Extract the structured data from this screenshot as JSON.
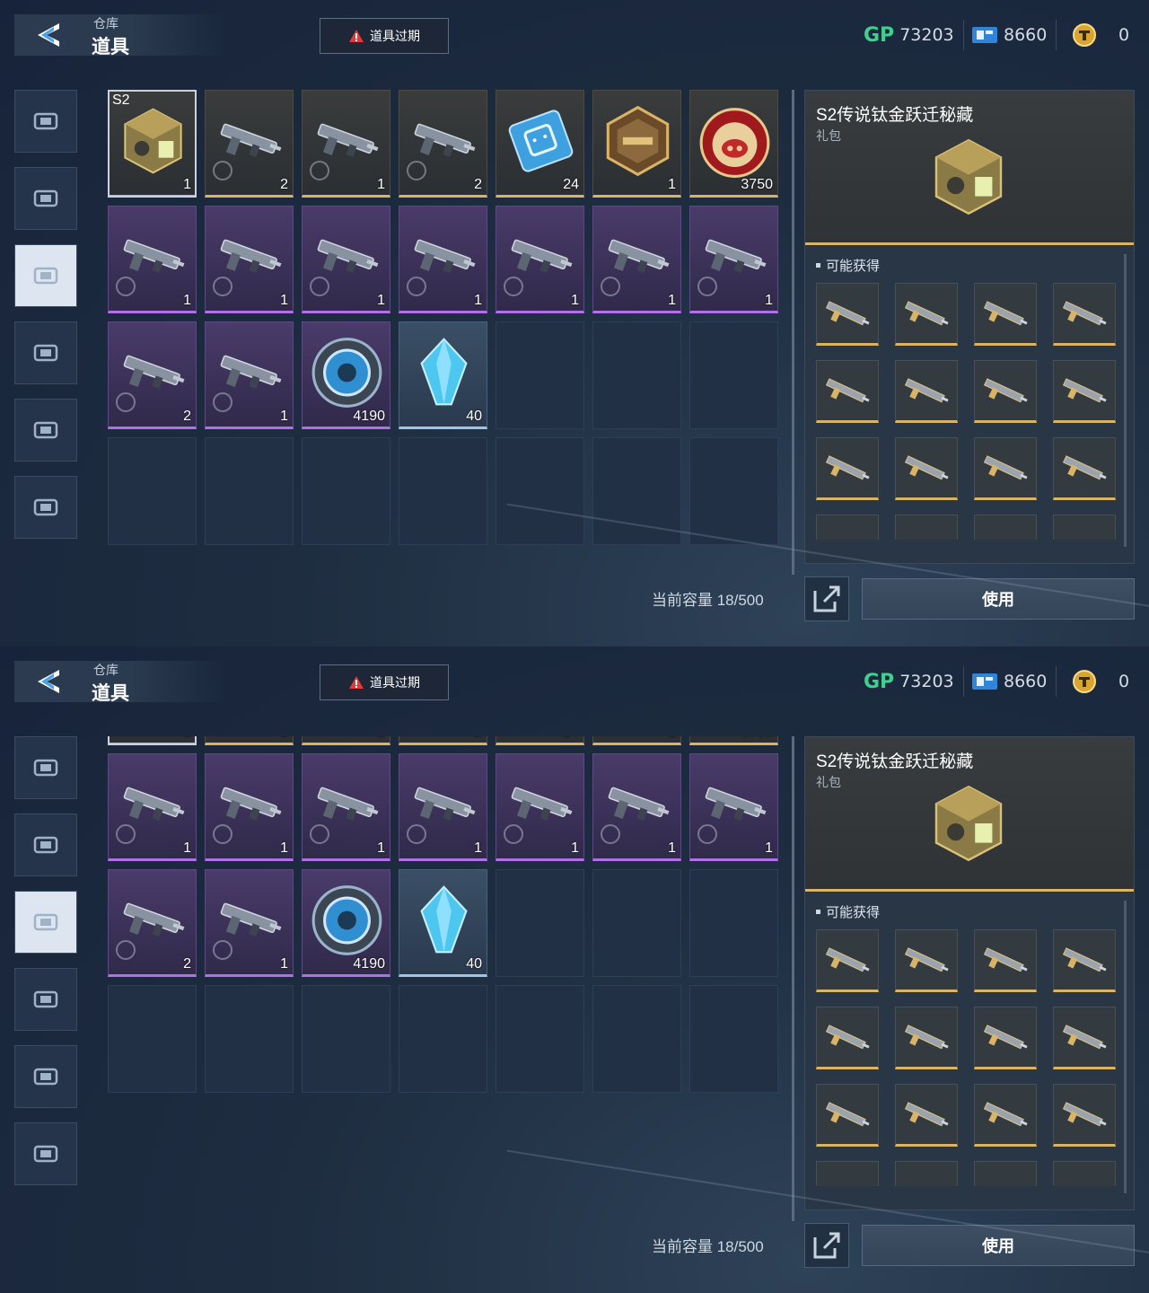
{
  "header": {
    "crumb": "仓库",
    "title": "道具",
    "expire_label": "道具过期",
    "currencies": [
      {
        "icon": "gp-icon",
        "label": "GP",
        "value": "73203"
      },
      {
        "icon": "ticket-icon",
        "value": "8660"
      },
      {
        "icon": "coin-icon",
        "value": "0"
      }
    ]
  },
  "sidebar": {
    "tabs": [
      {
        "icon": "pistol-icon",
        "active": false
      },
      {
        "icon": "frame-icon",
        "active": false
      },
      {
        "icon": "consumable-icon",
        "active": true
      },
      {
        "icon": "gun-swap-icon",
        "active": false
      },
      {
        "icon": "compass-icon",
        "active": false
      },
      {
        "icon": "star-badge-icon",
        "active": false
      }
    ]
  },
  "inventory": {
    "rows": [
      [
        {
          "name": "gift-crate",
          "rarity": "gold",
          "tag": "S2",
          "count": "1",
          "selected": true
        },
        {
          "name": "rifle-skin",
          "rarity": "gold",
          "count": "2",
          "timed": true
        },
        {
          "name": "pistol-skin",
          "rarity": "gold",
          "count": "1",
          "timed": true
        },
        {
          "name": "blade-skin",
          "rarity": "gold",
          "count": "2",
          "timed": true
        },
        {
          "name": "chip-card",
          "rarity": "gold",
          "count": "24"
        },
        {
          "name": "hex-badge",
          "rarity": "gold",
          "count": "1"
        },
        {
          "name": "pig-coin",
          "rarity": "gold",
          "count": "3750",
          "timer": true
        }
      ],
      [
        {
          "name": "smg-skin",
          "rarity": "purple",
          "count": "1",
          "timed": true
        },
        {
          "name": "ar-skin-green",
          "rarity": "purple",
          "count": "1",
          "timed": true
        },
        {
          "name": "rocket-skin",
          "rarity": "purple",
          "count": "1",
          "timed": true
        },
        {
          "name": "bow-skin",
          "rarity": "purple",
          "count": "1",
          "timed": true
        },
        {
          "name": "ar-skin-camo",
          "rarity": "purple",
          "count": "1",
          "timed": true
        },
        {
          "name": "shotgun-skin",
          "rarity": "purple",
          "count": "1",
          "timed": true
        },
        {
          "name": "smg-skin-white",
          "rarity": "purple",
          "count": "1",
          "timed": true
        }
      ],
      [
        {
          "name": "bow-skin-b",
          "rarity": "purple",
          "count": "2",
          "timed": true
        },
        {
          "name": "bow-skin-c",
          "rarity": "purple",
          "count": "1",
          "timed": true
        },
        {
          "name": "token-disc",
          "rarity": "purple",
          "count": "4190"
        },
        {
          "name": "crystal",
          "rarity": "blue",
          "count": "40"
        },
        {
          "empty": true
        },
        {
          "empty": true
        },
        {
          "empty": true
        }
      ],
      [
        {
          "empty": true
        },
        {
          "empty": true
        },
        {
          "empty": true
        },
        {
          "empty": true
        },
        {
          "empty": true
        },
        {
          "empty": true
        },
        {
          "empty": true
        }
      ]
    ],
    "capacity_label": "当前容量 18/500"
  },
  "detail": {
    "name": "S2传说钛金跃迁秘藏",
    "type": "礼包",
    "may_obtain_label": "可能获得",
    "rewards": [
      "knives-icon",
      "golden-rifle-icon",
      "sniper-icon",
      "pistol-skin-icon",
      "blade-icon",
      "knife-icon",
      "golden-smg-icon",
      "rifle-icon",
      "pistol-gold-icon",
      "blade-gold-icon",
      "knives-b-icon",
      "golden-ar-icon"
    ]
  },
  "actions": {
    "use_label": "使用"
  },
  "colors": {
    "gold": "#d9b466",
    "purple": "#b070e6",
    "blue": "#9ec4e8",
    "gp": "#3fd08c"
  }
}
